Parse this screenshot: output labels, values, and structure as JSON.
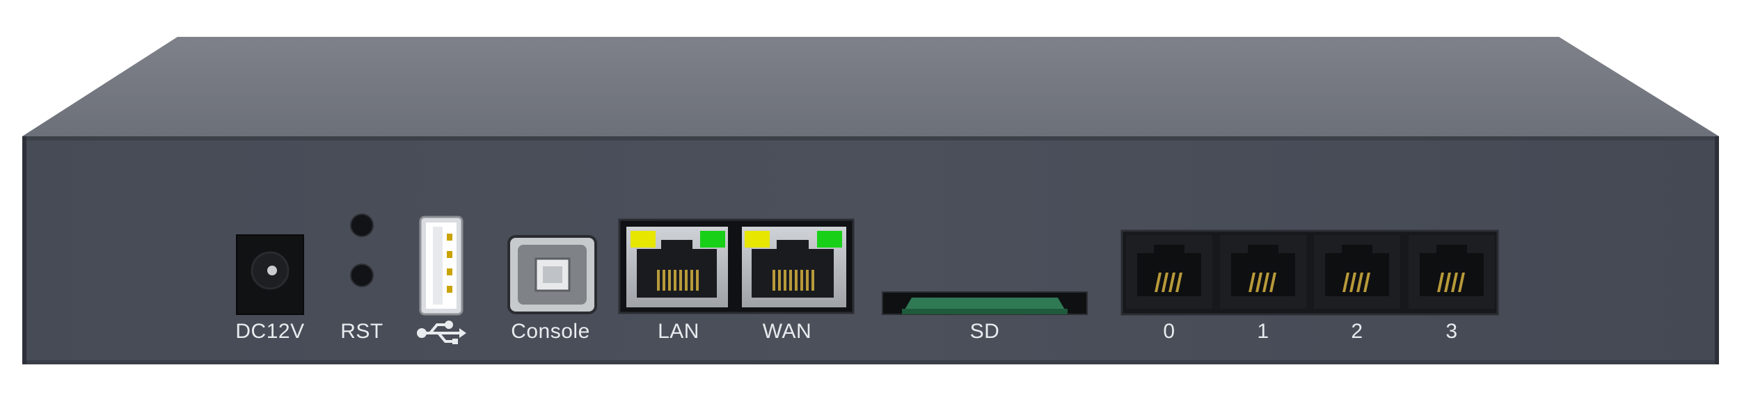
{
  "device": {
    "colors": {
      "top": "#7a7d85",
      "front": "#4a4e58",
      "label": "#e9ecef",
      "led_yellow": "#e6e600",
      "led_green": "#19d019",
      "sd_pcb": "#2f7a55"
    }
  },
  "ports": {
    "dc": {
      "label": "DC12V"
    },
    "rst": {
      "label": "RST"
    },
    "usb": {
      "icon": "usb-icon"
    },
    "console": {
      "label": "Console"
    },
    "lan": {
      "label": "LAN"
    },
    "wan": {
      "label": "WAN"
    },
    "sd": {
      "label": "SD"
    },
    "fxs": [
      {
        "label": "0"
      },
      {
        "label": "1"
      },
      {
        "label": "2"
      },
      {
        "label": "3"
      }
    ]
  }
}
